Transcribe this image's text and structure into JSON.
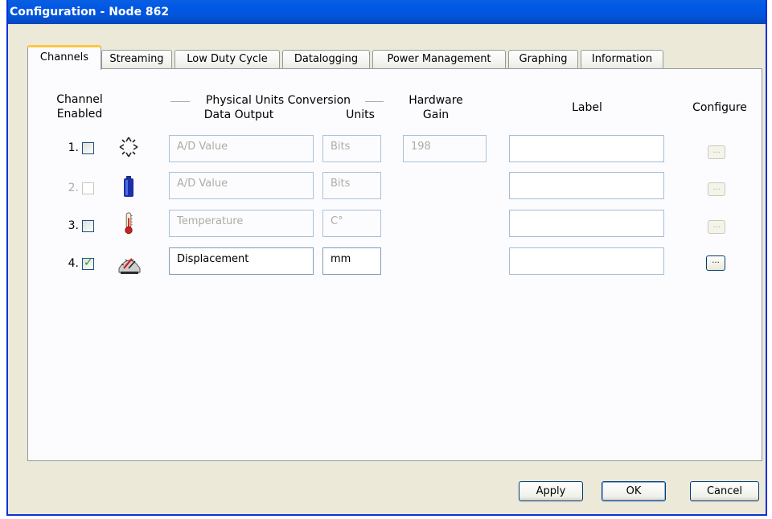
{
  "window": {
    "title": "Configuration - Node 862"
  },
  "tabs": [
    "Channels",
    "Streaming",
    "Low Duty Cycle",
    "Datalogging",
    "Power Management",
    "Graphing",
    "Information"
  ],
  "active_tab": "Channels",
  "headers": {
    "channel_enabled": [
      "Channel",
      "Enabled"
    ],
    "physical_units_conversion": "Physical Units Conversion",
    "data_output": "Data Output",
    "units": "Units",
    "hardware_gain": [
      "Hardware",
      "Gain"
    ],
    "label": "Label",
    "configure": "Configure"
  },
  "channels": [
    {
      "number": "1.",
      "enabled": false,
      "disabled": false,
      "icon": "sine-wave-icon",
      "data_output": "A/D Value",
      "units": "Bits",
      "hardware_gain": "198",
      "label": "",
      "configure_label": "..."
    },
    {
      "number": "2.",
      "enabled": false,
      "disabled": true,
      "icon": "battery-icon",
      "data_output": "A/D Value",
      "units": "Bits",
      "hardware_gain": null,
      "label": "",
      "configure_label": "..."
    },
    {
      "number": "3.",
      "enabled": false,
      "disabled": false,
      "icon": "thermometer-icon",
      "data_output": "Temperature",
      "units": "C°",
      "hardware_gain": null,
      "label": "",
      "configure_label": "..."
    },
    {
      "number": "4.",
      "enabled": true,
      "disabled": false,
      "icon": "gauge-icon",
      "data_output": "Displacement",
      "units": "mm",
      "hardware_gain": null,
      "label": "",
      "configure_label": "..."
    }
  ],
  "buttons": {
    "apply": "Apply",
    "ok": "OK",
    "cancel": "Cancel"
  },
  "colors": {
    "title_bar": "#0a5fe0",
    "dialog_bg": "#ece9d8",
    "active_tab_accent": "#ffc83c",
    "checkmark": "#21a121"
  }
}
